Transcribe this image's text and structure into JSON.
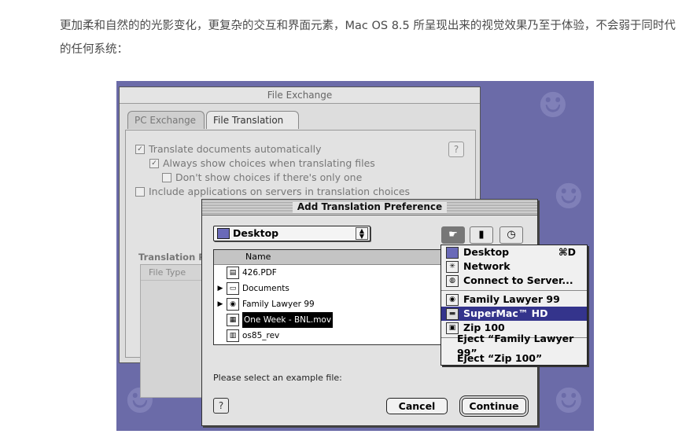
{
  "intro": "更加柔和自然的的光影变化，更复杂的交互和界面元素，Mac OS 8.5 所呈现出来的视觉效果乃至于体验，不会弱于同时代的任何系统：",
  "file_exchange": {
    "title": "File Exchange",
    "tabs": [
      "PC Exchange",
      "File Translation"
    ],
    "options": {
      "translate": "Translate documents automatically",
      "always_show": "Always show choices when translating files",
      "dont_show": "Don't show choices if there's only one",
      "include_apps": "Include applications on servers in translation choices"
    },
    "section": "Translation Pr",
    "col_file_type": "File Type",
    "help": "?"
  },
  "dialog": {
    "title": "Add Translation Preference",
    "location": "Desktop",
    "column_name": "Name",
    "files": [
      {
        "name": "426.PDF",
        "icon": "pdf-icon",
        "folder": false,
        "selected": false
      },
      {
        "name": "Documents",
        "icon": "folder-icon",
        "folder": true,
        "selected": false
      },
      {
        "name": "Family Lawyer 99",
        "icon": "cd-icon",
        "folder": true,
        "selected": false
      },
      {
        "name": "One Week - BNL.mov",
        "icon": "movie-icon",
        "folder": false,
        "selected": true
      },
      {
        "name": "os85_rev",
        "icon": "document-icon",
        "folder": false,
        "selected": false
      }
    ],
    "prompt": "Please select an example file:",
    "help": "?",
    "cancel": "Cancel",
    "continue": "Continue"
  },
  "menu": {
    "items": [
      {
        "label": "Desktop",
        "shortcut": "⌘D",
        "icon": "desktop-icon"
      },
      {
        "label": "Network",
        "icon": "network-icon"
      },
      {
        "label": "Connect to Server...",
        "icon": "globe-icon"
      },
      {
        "label": "Family Lawyer 99",
        "icon": "cd-icon"
      },
      {
        "label": "SuperMac™ HD",
        "icon": "hard-drive-icon",
        "highlighted": true
      },
      {
        "label": "Zip 100",
        "icon": "zip-disk-icon"
      },
      {
        "label": "Eject “Family Lawyer 99”"
      },
      {
        "label": "Eject “Zip 100”"
      }
    ]
  },
  "colors": {
    "desktop": "#6b6ba8",
    "highlight": "#34348c"
  }
}
